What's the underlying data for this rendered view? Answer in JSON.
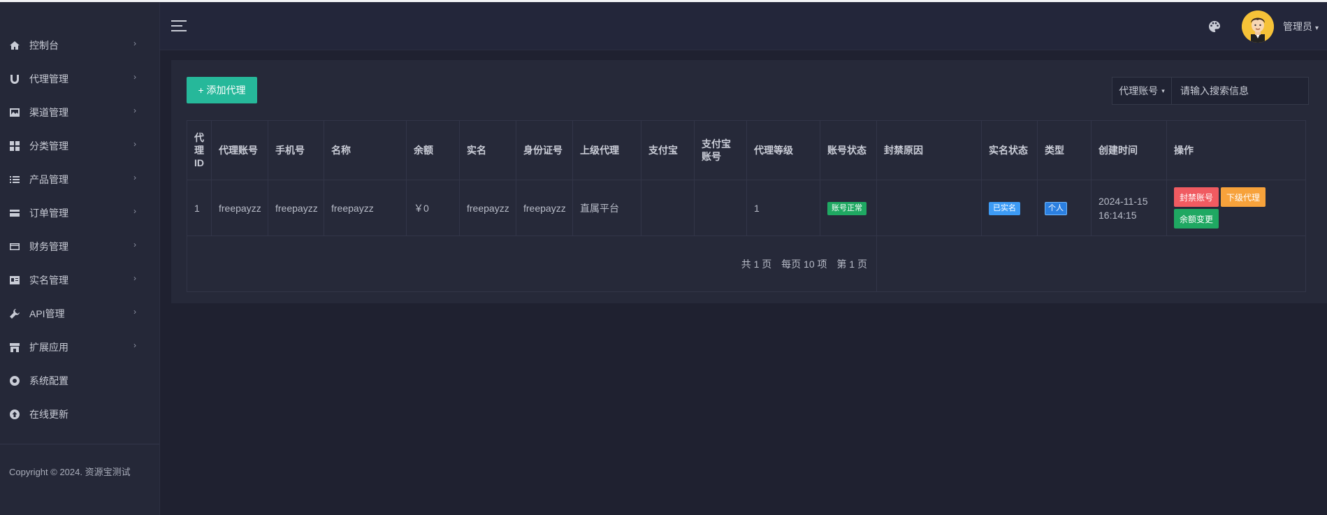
{
  "sidebar": {
    "items": [
      {
        "label": "控制台",
        "icon": "home-icon"
      },
      {
        "label": "代理管理",
        "icon": "magnet-icon"
      },
      {
        "label": "渠道管理",
        "icon": "chart-image-icon"
      },
      {
        "label": "分类管理",
        "icon": "grid-icon"
      },
      {
        "label": "产品管理",
        "icon": "list-icon"
      },
      {
        "label": "订单管理",
        "icon": "order-list-icon"
      },
      {
        "label": "财务管理",
        "icon": "credit-card-icon"
      },
      {
        "label": "实名管理",
        "icon": "id-card-icon"
      },
      {
        "label": "API管理",
        "icon": "wrench-icon"
      },
      {
        "label": "扩展应用",
        "icon": "store-icon"
      },
      {
        "label": "系统配置",
        "icon": "globe-gear-icon"
      },
      {
        "label": "在线更新",
        "icon": "upload-circle-icon"
      }
    ],
    "chevron": "›",
    "copyright": "Copyright © 2024. 资源宝测试"
  },
  "topbar": {
    "user_name": "管理员",
    "caret": "▾"
  },
  "toolbar": {
    "add_label": "+ 添加代理",
    "search_field_label": "代理账号",
    "search_caret": "▾",
    "search_placeholder": "请输入搜索信息"
  },
  "table": {
    "headers": [
      "代理ID",
      "代理账号",
      "手机号",
      "名称",
      "余额",
      "实名",
      "身份证号",
      "上级代理",
      "支付宝",
      "支付宝账号",
      "代理等级",
      "账号状态",
      "封禁原因",
      "实名状态",
      "类型",
      "创建时间",
      "操作"
    ],
    "rows": [
      {
        "id": "1",
        "account": "freepayzz",
        "phone": "freepayzz",
        "name": "freepayzz",
        "balance": "￥0",
        "realname": "freepayzz",
        "idcard": "freepayzz",
        "parent": "直属平台",
        "alipay": "",
        "alipay_account": "",
        "level": "1",
        "status": "账号正常",
        "ban_reason": "",
        "verify_status": "已实名",
        "type": "个人",
        "created": "2024-11-15 16:14:15",
        "actions": [
          "封禁账号",
          "下级代理",
          "余额变更"
        ]
      }
    ],
    "pager": {
      "total_pages": "共 1 页",
      "per_page": "每页 10 项",
      "current": "第 1 页"
    }
  },
  "colors": {
    "accent": "#26b89a",
    "danger": "#f05b61",
    "warning": "#f7a23b",
    "success": "#1fa862",
    "info": "#3d9bf5"
  }
}
